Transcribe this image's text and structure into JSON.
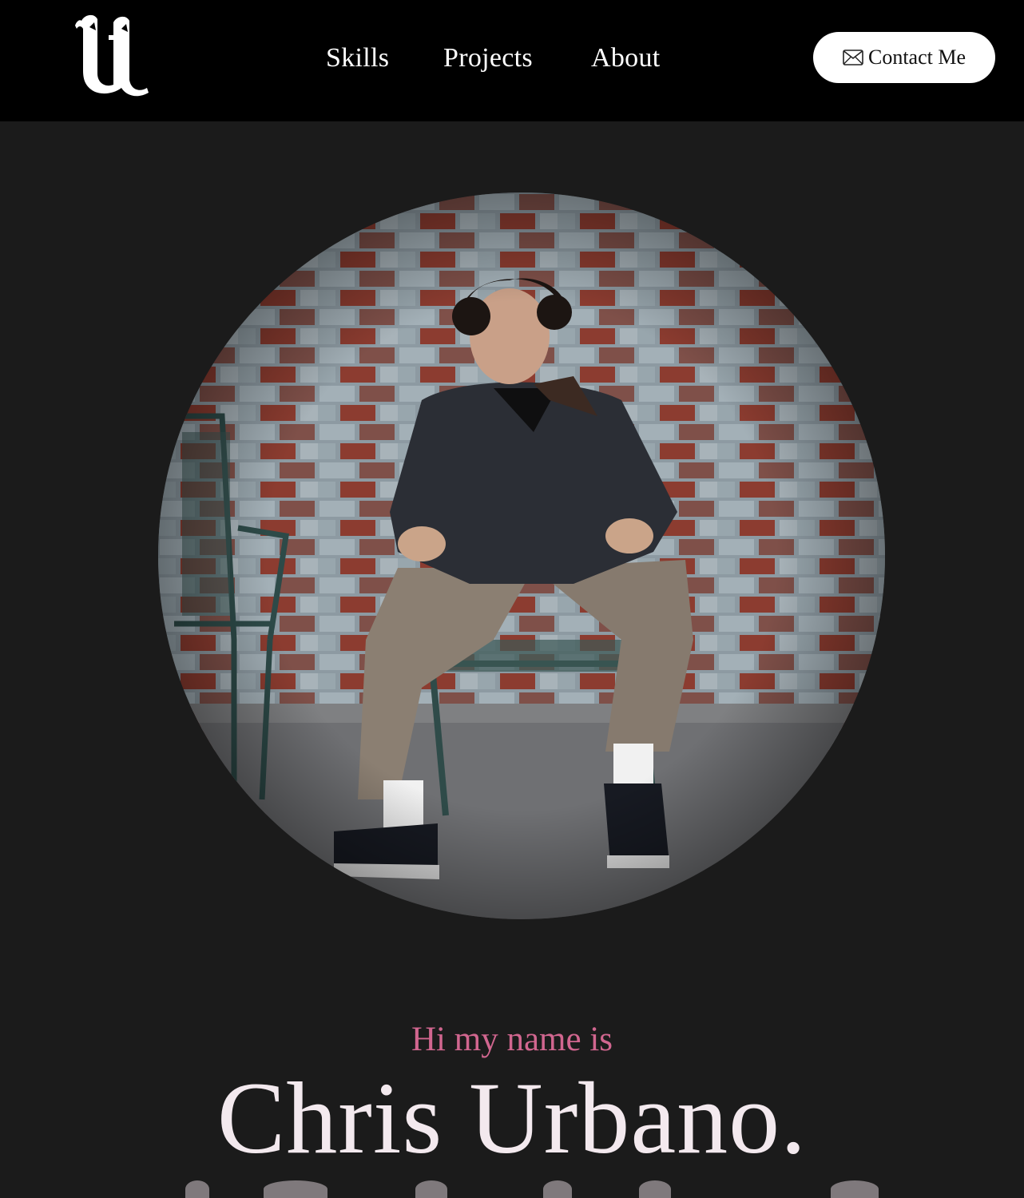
{
  "nav": {
    "logo_letter": "U",
    "links": [
      "Skills",
      "Projects",
      "About"
    ],
    "contact_label": "Contact Me"
  },
  "hero": {
    "intro": "Hi my name is",
    "name": "Chris Urbano."
  },
  "colors": {
    "navbar_bg": "#000000",
    "page_bg": "#1b1b1b",
    "intro_accent": "#d1668f",
    "name_text": "#f3e9ee",
    "button_bg": "#ffffff"
  },
  "icons": {
    "logo": "blackletter-u-logo",
    "contact": "mail-icon"
  }
}
